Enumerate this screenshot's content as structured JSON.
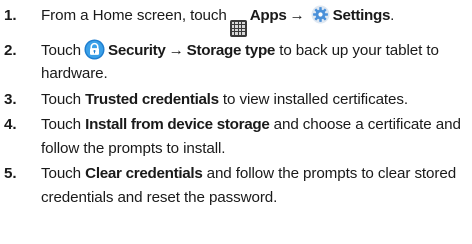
{
  "steps": [
    {
      "number": "1.",
      "text_a": "From a Home screen, touch",
      "apps_label": "Apps",
      "arrow": "→",
      "settings_label": "Settings",
      "text_end": "."
    },
    {
      "number": "2.",
      "text_a": "Touch",
      "security_label": "Security",
      "arrow": "→",
      "storage_label": "Storage type",
      "text_b": "to back up your tablet to hardware."
    },
    {
      "number": "3.",
      "text_a": "Touch",
      "option_label": "Trusted credentials",
      "text_b": "to view installed certificates."
    },
    {
      "number": "4.",
      "text_a": "Touch",
      "option_label": "Install from device storage",
      "text_b": "and choose a certificate and follow the prompts to install."
    },
    {
      "number": "5.",
      "text_a": "Touch",
      "option_label": "Clear credentials",
      "text_b": "and follow the prompts to clear stored credentials and reset the password."
    }
  ],
  "icons": {
    "apps": "apps-grid-icon",
    "settings": "settings-gear-icon",
    "security": "lock-icon"
  },
  "colors": {
    "text": "#1a1a1a",
    "security_icon": "#f5a623",
    "settings_icon": "#4a90d9"
  }
}
